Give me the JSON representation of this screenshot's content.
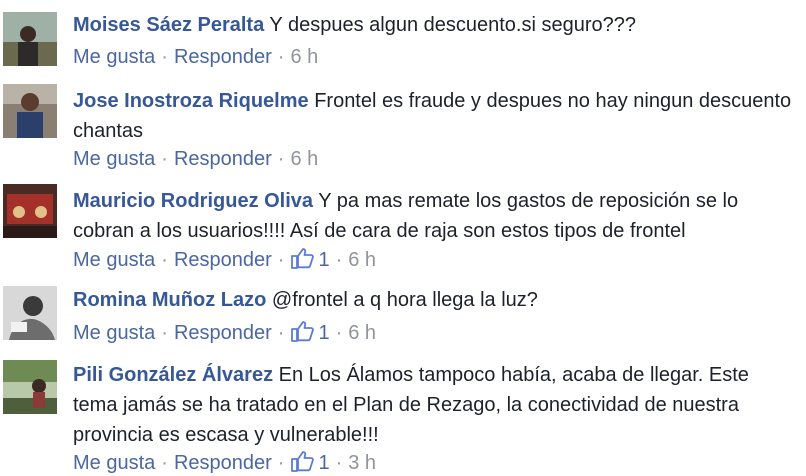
{
  "actions": {
    "like": "Me gusta",
    "reply": "Responder",
    "dot": "·"
  },
  "comments": [
    {
      "author": "Moises Sáez Peralta",
      "text": "Y despues algun descuento.si seguro???",
      "time": "6 h",
      "likes": ""
    },
    {
      "author": "Jose Inostroza Riquelme",
      "text": "Frontel es fraude y despues no hay ningun descuento chantas",
      "time": "6 h",
      "likes": ""
    },
    {
      "author": "Mauricio Rodriguez Oliva",
      "text": "Y pa mas remate los gastos de reposición se lo cobran a los usuarios!!!! Así de cara de raja son estos tipos de frontel",
      "time": "6 h",
      "likes": "1"
    },
    {
      "author": "Romina Muñoz Lazo",
      "text": "@frontel a q hora llega la luz?",
      "time": "6 h",
      "likes": "1"
    },
    {
      "author": "Pili González Álvarez",
      "text": "En Los Álamos tampoco había, acaba de llegar. Este tema jamás se ha tratado en el Plan de Rezago, la conectividad de nuestra provincia es escasa y vulnerable!!!",
      "time": "3 h",
      "likes": "1"
    }
  ],
  "colors": {
    "author": "#365899",
    "link": "#4b67a1",
    "meta": "#90949c",
    "text": "#1d2129"
  }
}
